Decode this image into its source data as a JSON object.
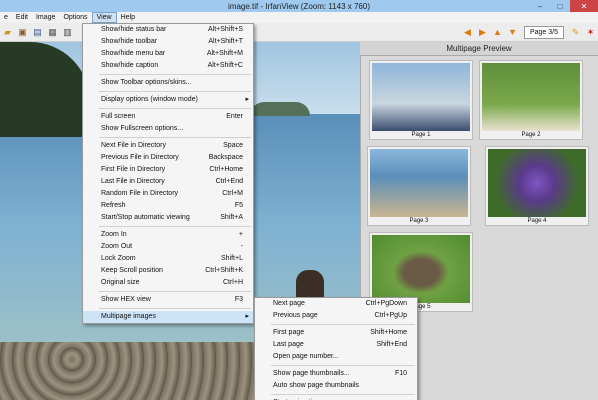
{
  "window": {
    "title": "image.tif - IrfanView (Zoom: 1143 x 760)",
    "minimize": "–",
    "maximize": "□",
    "close": "✕"
  },
  "menubar": [
    "e",
    "Edit",
    "Image",
    "Options",
    "View",
    "Help"
  ],
  "toolbar": {
    "page_label": "Page 3/5"
  },
  "preview": {
    "title": "Multipage Preview",
    "thumbs": [
      {
        "caption": "Page 1"
      },
      {
        "caption": "Page 2"
      },
      {
        "caption": "Page 3"
      },
      {
        "caption": "Page 4"
      },
      {
        "caption": "Page 5"
      }
    ]
  },
  "view_menu": [
    {
      "label": "Show/hide status bar",
      "shortcut": "Alt+Shift+S"
    },
    {
      "label": "Show/hide toolbar",
      "shortcut": "Alt+Shift+T"
    },
    {
      "label": "Show/hide menu bar",
      "shortcut": "Alt+Shift+M"
    },
    {
      "label": "Show/hide caption",
      "shortcut": "Alt+Shift+C"
    },
    {
      "sep": true
    },
    {
      "label": "Show Toolbar options/skins..."
    },
    {
      "sep": true
    },
    {
      "label": "Display options (window mode)",
      "arrow": "▸"
    },
    {
      "sep": true
    },
    {
      "label": "Full screen",
      "shortcut": "Enter"
    },
    {
      "label": "Show Fullscreen options..."
    },
    {
      "sep": true
    },
    {
      "label": "Next File in Directory",
      "shortcut": "Space"
    },
    {
      "label": "Previous File in Directory",
      "shortcut": "Backspace"
    },
    {
      "label": "First File in Directory",
      "shortcut": "Ctrl+Home"
    },
    {
      "label": "Last File in Directory",
      "shortcut": "Ctrl+End"
    },
    {
      "label": "Random File in Directory",
      "shortcut": "Ctrl+M"
    },
    {
      "label": "Refresh",
      "shortcut": "F5"
    },
    {
      "label": "Start/Stop automatic viewing",
      "shortcut": "Shift+A"
    },
    {
      "sep": true
    },
    {
      "label": "Zoom In",
      "shortcut": "+"
    },
    {
      "label": "Zoom Out",
      "shortcut": "-"
    },
    {
      "label": "Lock Zoom",
      "shortcut": "Shift+L"
    },
    {
      "label": "Keep Scroll position",
      "shortcut": "Ctrl+Shift+K"
    },
    {
      "label": "Original size",
      "shortcut": "Ctrl+H"
    },
    {
      "sep": true
    },
    {
      "label": "Show HEX view",
      "shortcut": "F3"
    },
    {
      "sep": true
    },
    {
      "label": "Multipage images",
      "arrow": "▸",
      "highlight": true
    }
  ],
  "multipage_menu": [
    {
      "label": "Next page",
      "shortcut": "Ctrl+PgDown"
    },
    {
      "label": "Previous page",
      "shortcut": "Ctrl+PgUp"
    },
    {
      "sep": true
    },
    {
      "label": "First page",
      "shortcut": "Shift+Home"
    },
    {
      "label": "Last page",
      "shortcut": "Shift+End"
    },
    {
      "label": "Open page number..."
    },
    {
      "sep": true
    },
    {
      "label": "Show page thumbnails...",
      "shortcut": "F10"
    },
    {
      "label": "Auto show page thumbnails"
    },
    {
      "sep": true
    },
    {
      "label": "Start animation..."
    }
  ],
  "icons": [
    "open-icon",
    "save-icon",
    "print-icon",
    "arrow-left-icon",
    "arrow-right-icon",
    "page-up-icon",
    "page-down-icon",
    "settings-icon",
    "irfanview-cat-icon"
  ]
}
